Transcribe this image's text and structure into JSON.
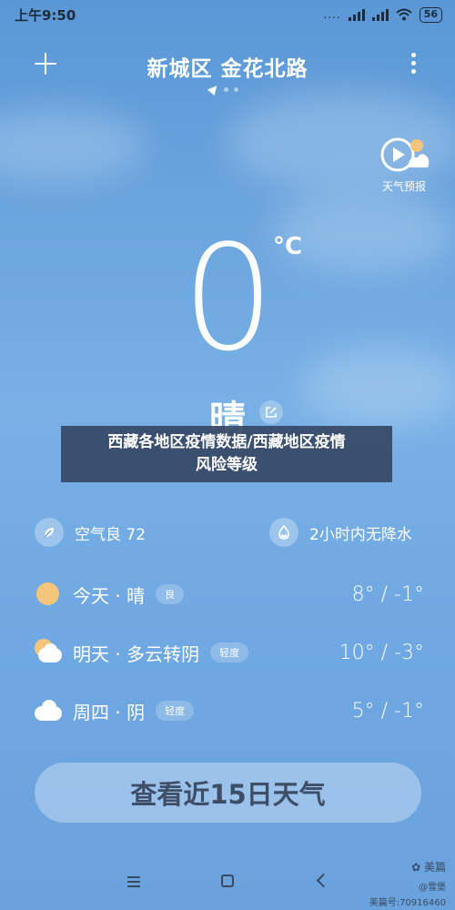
{
  "status_bar": {
    "time": "上午9:50",
    "network_dots": "....",
    "wifi": "wifi",
    "battery": "56"
  },
  "header": {
    "location": "新城区 金花北路",
    "add_icon": "plus-icon",
    "more_icon": "more-vertical-icon"
  },
  "forecast": {
    "label": "天气预报",
    "icon": "play-cloud-icon"
  },
  "current": {
    "temperature": "0",
    "unit": "°C",
    "condition": "晴"
  },
  "overlay": {
    "line1": "西藏各地区疫情数据/西藏地区疫情",
    "line2": "风险等级"
  },
  "air_quality": {
    "label": "空气良 72",
    "icon": "leaf-icon"
  },
  "rain": {
    "label": "2小时内无降水",
    "icon": "raindrop-icon"
  },
  "days": [
    {
      "name": "今天 · 晴",
      "badge": "良",
      "temp": "8° / -1°",
      "icon": "sun-icon"
    },
    {
      "name": "明天 · 多云转阴",
      "badge": "轻度",
      "temp": "10° / -3°",
      "icon": "sun-cloud-icon"
    },
    {
      "name": "周四 · 阴",
      "badge": "轻度",
      "temp": "5° / -1°",
      "icon": "cloud-icon"
    }
  ],
  "more_button": {
    "label": "查看近15日天气"
  },
  "watermark": {
    "brand": "美篇",
    "author": "@雪堡",
    "id": "美篇号:70916460"
  },
  "colors": {
    "sky_top": "#5a97d6",
    "sky_bottom": "#6aa2de",
    "sun": "#f4c57a",
    "overlay": "#374866"
  }
}
